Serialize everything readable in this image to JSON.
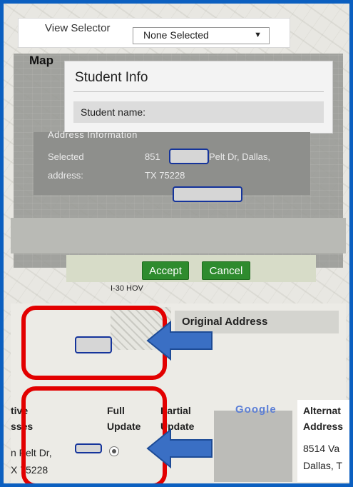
{
  "toolbar": {
    "view_selector_label": "View Selector",
    "selected_option": "None Selected"
  },
  "map": {
    "label": "Map"
  },
  "student_info": {
    "title": "Student Info",
    "name_label": "Student name:"
  },
  "address_panel": {
    "heading": "Address Information",
    "selected_label": "Selected",
    "address_label": "address:",
    "address_line1_start": "851",
    "address_line1_end": "Pelt Dr, Dallas,",
    "address_line2": "TX 75228"
  },
  "actions": {
    "accept_label": "Accept",
    "cancel_label": "Cancel"
  },
  "map_extra": {
    "hov_label": "I-30 HOV"
  },
  "table": {
    "original_address_header": "Original Address",
    "columns": {
      "active_line1": "tive",
      "active_line2": "sses",
      "full_line1": "Full",
      "full_line2": "Update",
      "partial_line1": "Partial",
      "partial_line2": "Update",
      "alternate_line1": "Alternat",
      "alternate_line2": "Address"
    },
    "row": {
      "current_line1": "n Pelt Dr,",
      "current_line2": "X 75228",
      "alternate_line1": "8514 Va",
      "alternate_line2": "Dallas, T"
    }
  },
  "colors": {
    "frame_border": "#0b5fc0",
    "button_green": "#2e8b2e",
    "callout_red": "#e20000",
    "arrow_blue": "#3a6fc4"
  }
}
